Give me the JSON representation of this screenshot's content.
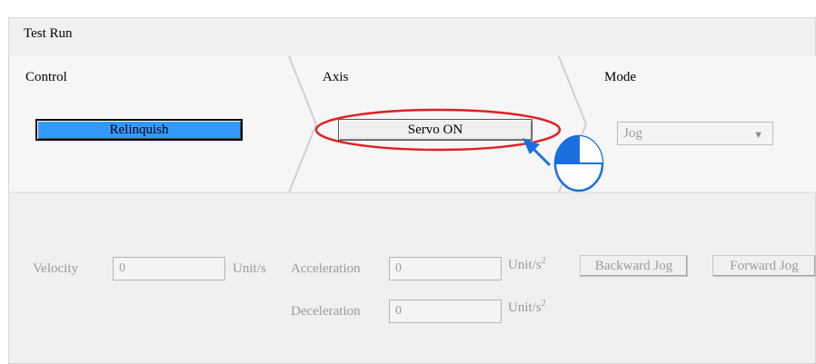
{
  "window": {
    "title": "Test Run"
  },
  "steps": [
    {
      "label": "Control"
    },
    {
      "label": "Axis"
    },
    {
      "label": "Mode"
    }
  ],
  "control": {
    "relinquish_label": "Relinquish"
  },
  "axis": {
    "servo_label": "Servo ON"
  },
  "mode": {
    "selected": "Jog"
  },
  "jog": {
    "velocity_label": "Velocity",
    "velocity_value": "0",
    "velocity_unit": "Unit/s",
    "acceleration_label": "Acceleration",
    "acceleration_value": "0",
    "acceleration_unit": "Unit/s",
    "deceleration_label": "Deceleration",
    "deceleration_value": "0",
    "deceleration_unit": "Unit/s",
    "unit_exponent": "2",
    "backward_label": "Backward Jog",
    "forward_label": "Forward Jog"
  },
  "annotation": {
    "highlight_color": "#e02020",
    "pointer_color": "#1a6fe0"
  },
  "icons": [
    "arrow-pointer-icon",
    "click-indicator-icon",
    "chevron-down-icon"
  ]
}
